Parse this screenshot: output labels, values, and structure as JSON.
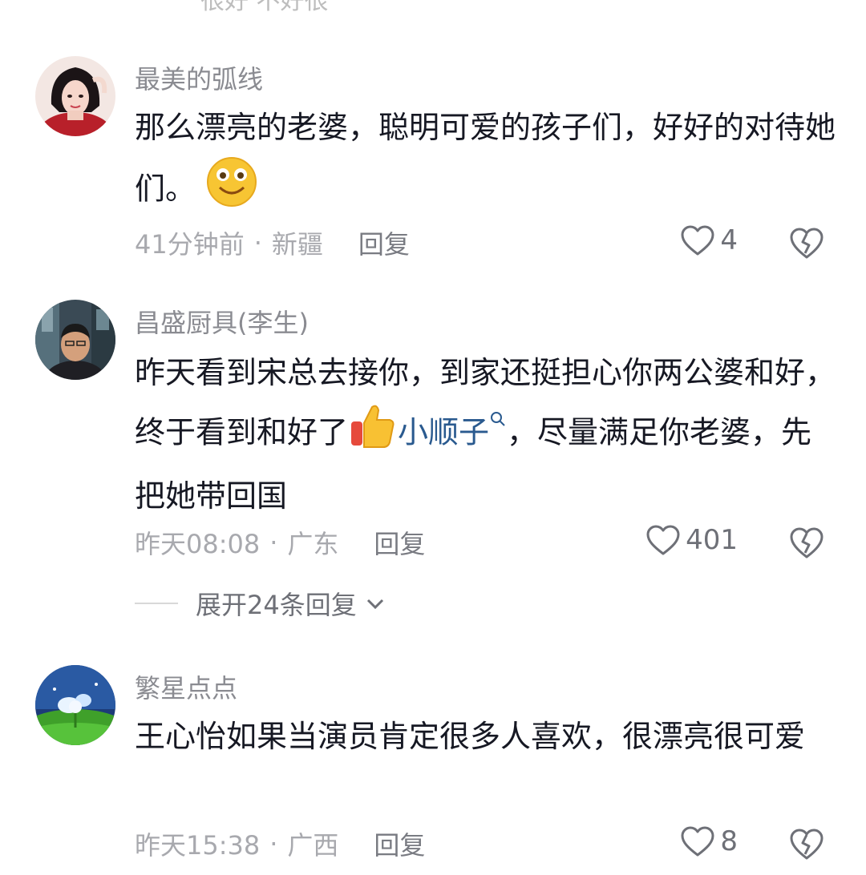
{
  "top_cut_text": "很好 不好很",
  "comments": [
    {
      "username": "最美的弧线",
      "text": "那么漂亮的老婆，聪明可爱的孩子们，好好的对待她们。",
      "emoji": "smile-emoji",
      "time": "41分钟前",
      "location": "新疆",
      "reply_label": "回复",
      "likes": "4"
    },
    {
      "username": "昌盛厨具(李生)",
      "text_part1": "昨天看到宋总去接你，到家还挺担心你两公婆和好，终于看到和好了",
      "emoji": "thumbs-up-emoji",
      "mention": "小顺子",
      "text_part2": "，尽量满足你老婆，先把她带回国",
      "time": "昨天08:08",
      "location": "广东",
      "reply_label": "回复",
      "likes": "401",
      "expand_label": "展开24条回复"
    },
    {
      "username": "繁星点点",
      "text": "王心怡如果当演员肯定很多人喜欢，很漂亮很可爱",
      "time": "昨天15:38",
      "location": "广西",
      "reply_label": "回复",
      "likes": "8"
    }
  ],
  "separator": "·",
  "colors": {
    "mention": "#2a5a8f",
    "meta": "#a8a9ae",
    "username": "#8a8b91"
  }
}
